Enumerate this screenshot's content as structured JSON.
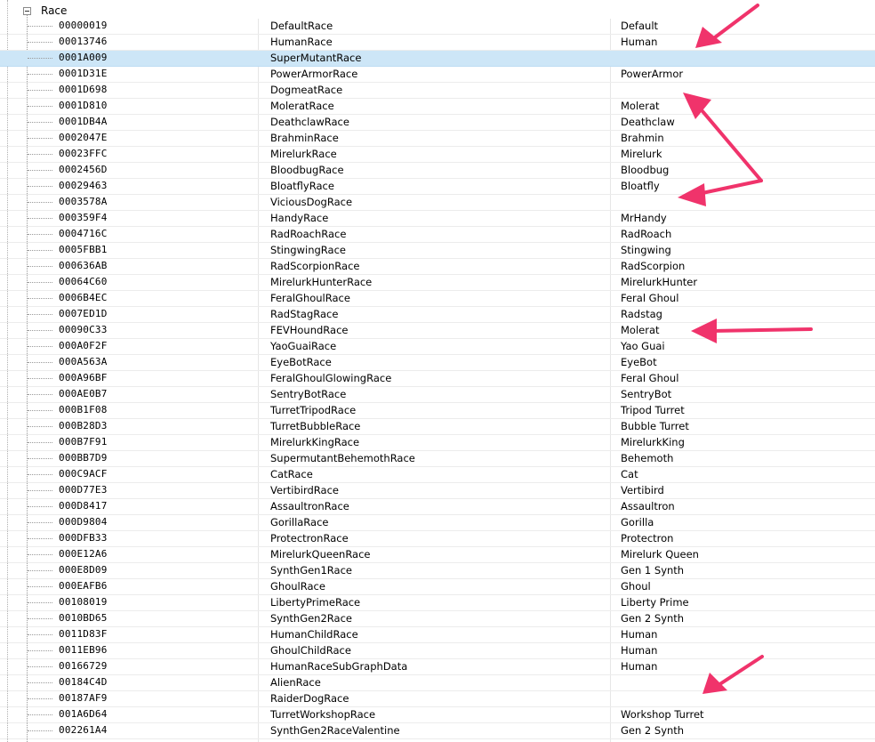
{
  "tree": {
    "root_label": "Race",
    "rows": [
      {
        "id": "00000019",
        "edid": "DefaultRace",
        "name": "Default"
      },
      {
        "id": "00013746",
        "edid": "HumanRace",
        "name": "Human"
      },
      {
        "id": "0001A009",
        "edid": "SuperMutantRace",
        "name": ""
      },
      {
        "id": "0001D31E",
        "edid": "PowerArmorRace",
        "name": "PowerArmor"
      },
      {
        "id": "0001D698",
        "edid": "DogmeatRace",
        "name": ""
      },
      {
        "id": "0001D810",
        "edid": "MoleratRace",
        "name": "Molerat"
      },
      {
        "id": "0001DB4A",
        "edid": "DeathclawRace",
        "name": "Deathclaw"
      },
      {
        "id": "0002047E",
        "edid": "BrahminRace",
        "name": "Brahmin"
      },
      {
        "id": "00023FFC",
        "edid": "MirelurkRace",
        "name": "Mirelurk"
      },
      {
        "id": "0002456D",
        "edid": "BloodbugRace",
        "name": "Bloodbug"
      },
      {
        "id": "00029463",
        "edid": "BloatflyRace",
        "name": "Bloatfly"
      },
      {
        "id": "0003578A",
        "edid": "ViciousDogRace",
        "name": ""
      },
      {
        "id": "000359F4",
        "edid": "HandyRace",
        "name": "MrHandy"
      },
      {
        "id": "0004716C",
        "edid": "RadRoachRace",
        "name": "RadRoach"
      },
      {
        "id": "0005FBB1",
        "edid": "StingwingRace",
        "name": "Stingwing"
      },
      {
        "id": "000636AB",
        "edid": "RadScorpionRace",
        "name": "RadScorpion"
      },
      {
        "id": "00064C60",
        "edid": "MirelurkHunterRace",
        "name": "MirelurkHunter"
      },
      {
        "id": "0006B4EC",
        "edid": "FeralGhoulRace",
        "name": "Feral Ghoul"
      },
      {
        "id": "0007ED1D",
        "edid": "RadStagRace",
        "name": "Radstag"
      },
      {
        "id": "00090C33",
        "edid": "FEVHoundRace",
        "name": "Molerat"
      },
      {
        "id": "000A0F2F",
        "edid": "YaoGuaiRace",
        "name": "Yao Guai"
      },
      {
        "id": "000A563A",
        "edid": "EyeBotRace",
        "name": "EyeBot"
      },
      {
        "id": "000A96BF",
        "edid": "FeralGhoulGlowingRace",
        "name": "Feral Ghoul"
      },
      {
        "id": "000AE0B7",
        "edid": "SentryBotRace",
        "name": "SentryBot"
      },
      {
        "id": "000B1F08",
        "edid": "TurretTripodRace",
        "name": "Tripod Turret"
      },
      {
        "id": "000B28D3",
        "edid": "TurretBubbleRace",
        "name": "Bubble Turret"
      },
      {
        "id": "000B7F91",
        "edid": "MirelurkKingRace",
        "name": "MirelurkKing"
      },
      {
        "id": "000BB7D9",
        "edid": "SupermutantBehemothRace",
        "name": "Behemoth"
      },
      {
        "id": "000C9ACF",
        "edid": "CatRace",
        "name": "Cat"
      },
      {
        "id": "000D77E3",
        "edid": "VertibirdRace",
        "name": "Vertibird"
      },
      {
        "id": "000D8417",
        "edid": "AssaultronRace",
        "name": "Assaultron"
      },
      {
        "id": "000D9804",
        "edid": "GorillaRace",
        "name": "Gorilla"
      },
      {
        "id": "000DFB33",
        "edid": "ProtectronRace",
        "name": "Protectron"
      },
      {
        "id": "000E12A6",
        "edid": "MirelurkQueenRace",
        "name": "Mirelurk Queen"
      },
      {
        "id": "000E8D09",
        "edid": "SynthGen1Race",
        "name": "Gen 1 Synth"
      },
      {
        "id": "000EAFB6",
        "edid": "GhoulRace",
        "name": "Ghoul"
      },
      {
        "id": "00108019",
        "edid": "LibertyPrimeRace",
        "name": "Liberty Prime"
      },
      {
        "id": "0010BD65",
        "edid": "SynthGen2Race",
        "name": "Gen 2 Synth"
      },
      {
        "id": "0011D83F",
        "edid": "HumanChildRace",
        "name": "Human"
      },
      {
        "id": "0011EB96",
        "edid": "GhoulChildRace",
        "name": "Human"
      },
      {
        "id": "00166729",
        "edid": "HumanRaceSubGraphData",
        "name": "Human"
      },
      {
        "id": "00184C4D",
        "edid": "AlienRace",
        "name": ""
      },
      {
        "id": "00187AF9",
        "edid": "RaiderDogRace",
        "name": ""
      },
      {
        "id": "001A6D64",
        "edid": "TurretWorkshopRace",
        "name": "Workshop Turret"
      },
      {
        "id": "002261A4",
        "edid": "SynthGen2RaceValentine",
        "name": "Gen 2 Synth"
      }
    ],
    "selected_id": "0001A009"
  },
  "colors": {
    "selection": "#cde6f7",
    "arrow": "#f0336b"
  }
}
